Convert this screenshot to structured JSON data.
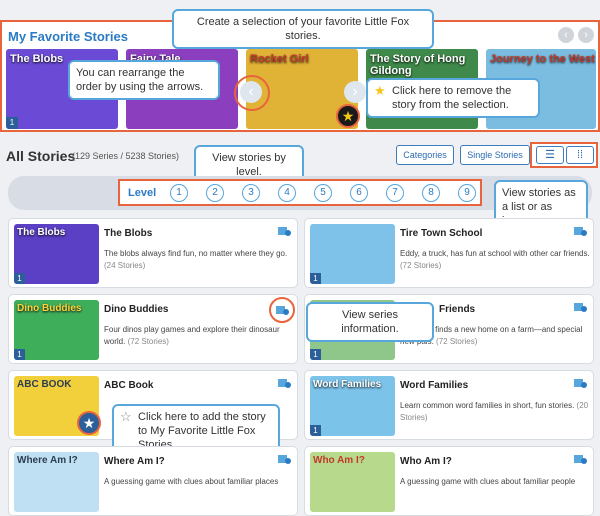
{
  "favorites": {
    "title": "My Favorite Stories",
    "prev_icon": "chevron-left-icon",
    "next_icon": "chevron-right-icon",
    "items": [
      {
        "label": "The Blobs",
        "level": "1",
        "color": "#6b4bd6"
      },
      {
        "label": "Fairy Tale",
        "level": "",
        "color": "#8b3fbf"
      },
      {
        "label": "Rocket Girl",
        "level": "",
        "color": "#e0b236"
      },
      {
        "label": "The Story of Hong Gildong",
        "level": "",
        "color": "#3f8a4a"
      },
      {
        "label": "Journey to the West",
        "level": "",
        "color": "#7bbde0"
      }
    ]
  },
  "callouts": {
    "create": "Create a selection of your favorite Little Fox stories.",
    "rearrange": "You can rearrange the order by using the arrows.",
    "remove": "Click here to remove the story from the selection.",
    "by_level": "View stories by level.",
    "view_mode": "View stories as a list or as images.",
    "series_info": "View series information.",
    "add": "Click here to add the story to My Favorite Little Fox Stories."
  },
  "all_stories": {
    "title": "All Stories",
    "count": "(129 Series / 5238 Stories)",
    "categories_label": "Categories",
    "single_label": "Single Stories",
    "list_icon": "list-view-icon",
    "grid_icon": "grid-view-icon"
  },
  "levels": {
    "label": "Level",
    "items": [
      "1",
      "2",
      "3",
      "4",
      "5",
      "6",
      "7",
      "8",
      "9"
    ]
  },
  "series": [
    {
      "title": "The Blobs",
      "desc": "The blobs always find fun, no matter where they go.",
      "count": "(24 Stories)",
      "thumb": "The Blobs",
      "level": "1",
      "color": "#5b3fc4"
    },
    {
      "title": "Tire Town School",
      "desc": "Eddy, a truck, has fun at school with other car friends.",
      "count": "(72 Stories)",
      "thumb": "",
      "level": "1",
      "color": "#7ec2ea"
    },
    {
      "title": "Dino Buddies",
      "desc": "Four dinos play games and explore their dinosaur world.",
      "count": "(72 Stories)",
      "thumb": "Dino Buddies",
      "level": "1",
      "color": "#3fae5a"
    },
    {
      "title": "Friends",
      "desc": "A lost bat finds a new home on a farm—and special new pals.",
      "count": "(72 Stories)",
      "thumb": "",
      "level": "1",
      "color": "#8fc78a"
    },
    {
      "title": "ABC Book",
      "desc": "",
      "count": "",
      "thumb": "ABC BOOK",
      "level": "",
      "color": "#f2d03c"
    },
    {
      "title": "Word Families",
      "desc": "Learn common word families in short, fun stories.",
      "count": "(20 Stories)",
      "thumb": "Word Families",
      "level": "1",
      "color": "#7cc3ea"
    },
    {
      "title": "Where Am I?",
      "desc": "A guessing game with clues about familiar places",
      "count": "",
      "thumb": "Where Am I?",
      "level": "",
      "color": "#bfe0f2"
    },
    {
      "title": "Who Am I?",
      "desc": "A guessing game with clues about familiar people",
      "count": "",
      "thumb": "Who Am I?",
      "level": "",
      "color": "#b7d98c"
    }
  ],
  "colors": {
    "accent": "#2b7bc4",
    "highlight": "#e8643c",
    "callout_border": "#57a6dc"
  }
}
